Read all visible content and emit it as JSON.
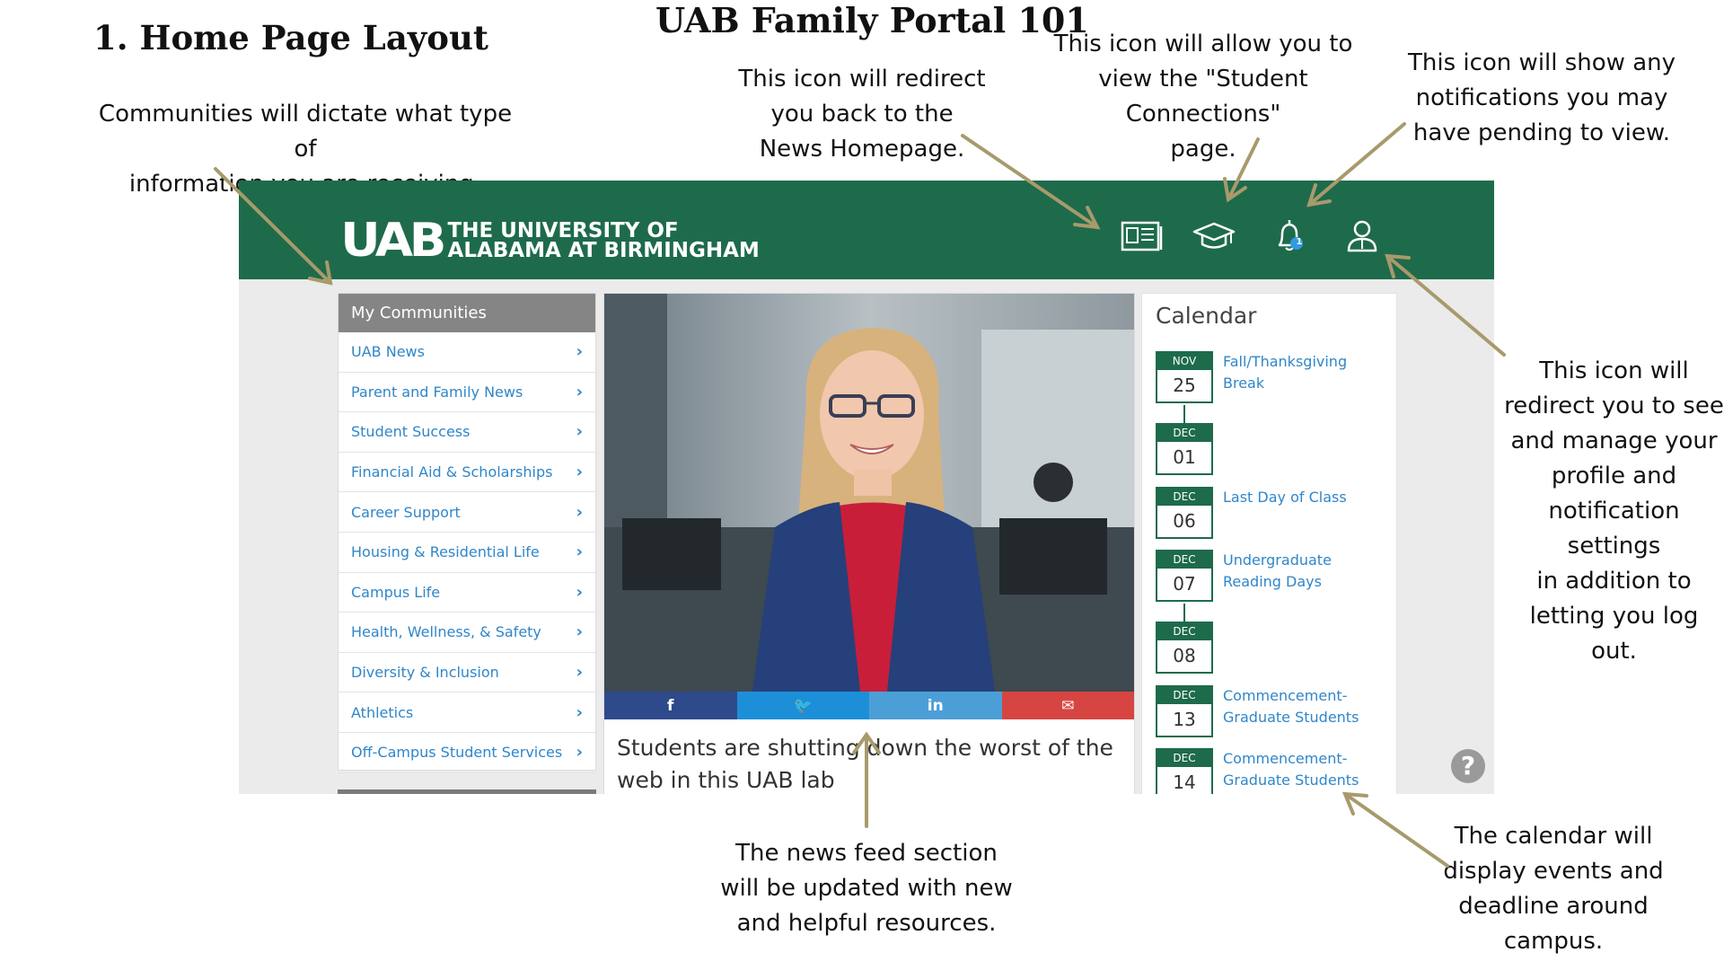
{
  "headings": {
    "section": "1. Home Page Layout",
    "title": "UAB Family Portal 101"
  },
  "annotations": {
    "communities": [
      "Communities will dictate what type of",
      "information you are receiving."
    ],
    "news_icon": [
      "This icon will redirect",
      "you back to the",
      "News Homepage."
    ],
    "student_icon": [
      "This icon will allow you to",
      "view the \"Student",
      "Connections\"",
      "page."
    ],
    "notifications_icon": [
      "This icon will show any",
      "notifications you may",
      "have pending to view."
    ],
    "profile_icon": [
      "This icon will",
      "redirect you to see",
      "and manage your",
      "profile and",
      "notification settings",
      "in addition to",
      "letting you log out."
    ],
    "news_feed": [
      "The news feed section",
      "will be updated with new",
      "and helpful resources."
    ],
    "calendar": [
      "The calendar will",
      "display events and",
      "deadline around",
      "campus."
    ]
  },
  "portal": {
    "logo": {
      "mark": "UAB",
      "line1": "THE UNIVERSITY OF",
      "line2": "ALABAMA AT BIRMINGHAM"
    },
    "header_icons": [
      "news-icon",
      "graduation-cap-icon",
      "bell-icon",
      "user-profile-icon"
    ],
    "notification_count": "1",
    "communities": {
      "header": "My Communities",
      "items": [
        "UAB News",
        "Parent and Family News",
        "Student Success",
        "Financial Aid & Scholarships",
        "Career Support",
        "Housing & Residential Life",
        "Campus Life",
        "Health, Wellness, & Safety",
        "Diversity & Inclusion",
        "Athletics",
        "Off-Campus Student Services"
      ]
    },
    "news": {
      "share_icons": [
        "facebook-icon",
        "twitter-icon",
        "linkedin-icon",
        "email-icon"
      ],
      "share_glyphs": [
        "f",
        "🐦",
        "in",
        "✉"
      ],
      "headline_line1": "Students are shutting down the worst of the",
      "headline_line2": "web in this UAB lab"
    },
    "calendar": {
      "title": "Calendar",
      "events": [
        {
          "month": "NOV",
          "day": "25",
          "label": [
            "Fall/Thanksgiving",
            "Break"
          ]
        },
        {
          "month": "DEC",
          "day": "01",
          "label": []
        },
        {
          "month": "DEC",
          "day": "06",
          "label": [
            "Last Day of Class"
          ]
        },
        {
          "month": "DEC",
          "day": "07",
          "label": [
            "Undergraduate",
            "Reading Days"
          ]
        },
        {
          "month": "DEC",
          "day": "08",
          "label": []
        },
        {
          "month": "DEC",
          "day": "13",
          "label": [
            "Commencement-",
            "Graduate Students"
          ]
        },
        {
          "month": "DEC",
          "day": "14",
          "label": [
            "Commencement-",
            "Graduate Students"
          ]
        }
      ]
    },
    "help_label": "?"
  },
  "colors": {
    "uab_green": "#1e6b4b",
    "link_blue": "#2f86c9",
    "arrow": "#a89a6c",
    "facebook": "#3b5998",
    "twitter": "#1d8fd8",
    "linkedin": "#4c9fd6",
    "email": "#d64541"
  }
}
